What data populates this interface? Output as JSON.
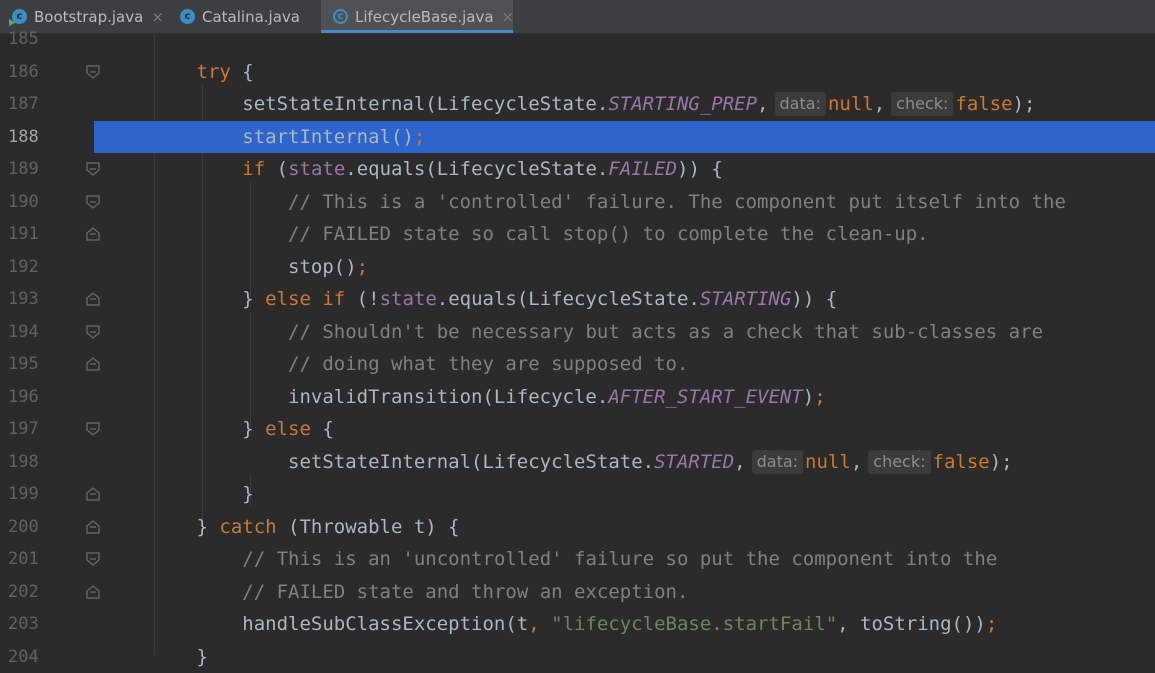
{
  "tabs": [
    {
      "label": "Bootstrap.java",
      "icon": "java-class-run-icon",
      "active": false
    },
    {
      "label": "Catalina.java",
      "icon": "java-class-icon",
      "active": false
    },
    {
      "label": "LifecycleBase.java",
      "icon": "java-abstract-class-icon",
      "active": true
    }
  ],
  "tab_close_glyph": "×",
  "class_letter": "c",
  "editor": {
    "current_line": 188,
    "lines": [
      {
        "num": "185",
        "fold": "none",
        "tokens": []
      },
      {
        "num": "186",
        "fold": "down",
        "tokens": [
          {
            "t": "        "
          },
          {
            "t": "try",
            "c": "kw"
          },
          {
            "t": " {"
          }
        ]
      },
      {
        "num": "187",
        "fold": "none",
        "tokens": [
          {
            "t": "            setStateInternal(LifecycleState."
          },
          {
            "t": "STARTING_PREP",
            "c": "cst"
          },
          {
            "t": ","
          },
          {
            "t": "data:",
            "c": "hint"
          },
          {
            "t": "null",
            "c": "kw"
          },
          {
            "t": ","
          },
          {
            "t": "check:",
            "c": "hint"
          },
          {
            "t": "false",
            "c": "kw"
          },
          {
            "t": ");"
          }
        ]
      },
      {
        "num": "188",
        "fold": "none",
        "tokens": [
          {
            "t": "            startInternal()"
          },
          {
            "t": ";",
            "c": "kw"
          }
        ]
      },
      {
        "num": "189",
        "fold": "down",
        "tokens": [
          {
            "t": "            "
          },
          {
            "t": "if",
            "c": "kw"
          },
          {
            "t": " ("
          },
          {
            "t": "state",
            "c": "fld"
          },
          {
            "t": ".equals(LifecycleState."
          },
          {
            "t": "FAILED",
            "c": "cst"
          },
          {
            "t": ")) {"
          }
        ]
      },
      {
        "num": "190",
        "fold": "down",
        "tokens": [
          {
            "t": "                "
          },
          {
            "t": "// This is a 'controlled' failure. The component put itself into the",
            "c": "cmt"
          }
        ]
      },
      {
        "num": "191",
        "fold": "up",
        "tokens": [
          {
            "t": "                "
          },
          {
            "t": "// FAILED state so call stop() to complete the clean-up.",
            "c": "cmt"
          }
        ]
      },
      {
        "num": "192",
        "fold": "none",
        "tokens": [
          {
            "t": "                stop()"
          },
          {
            "t": ";",
            "c": "kw"
          }
        ]
      },
      {
        "num": "193",
        "fold": "up",
        "tokens": [
          {
            "t": "            } "
          },
          {
            "t": "else if",
            "c": "kw"
          },
          {
            "t": " (!"
          },
          {
            "t": "state",
            "c": "fld"
          },
          {
            "t": ".equals(LifecycleState."
          },
          {
            "t": "STARTING",
            "c": "cst"
          },
          {
            "t": ")) {"
          }
        ]
      },
      {
        "num": "194",
        "fold": "down",
        "tokens": [
          {
            "t": "                "
          },
          {
            "t": "// Shouldn't be necessary but acts as a check that sub-classes are",
            "c": "cmt"
          }
        ]
      },
      {
        "num": "195",
        "fold": "up",
        "tokens": [
          {
            "t": "                "
          },
          {
            "t": "// doing what they are supposed to.",
            "c": "cmt"
          }
        ]
      },
      {
        "num": "196",
        "fold": "none",
        "tokens": [
          {
            "t": "                invalidTransition(Lifecycle."
          },
          {
            "t": "AFTER_START_EVENT",
            "c": "cst"
          },
          {
            "t": ")"
          },
          {
            "t": ";",
            "c": "kw"
          }
        ]
      },
      {
        "num": "197",
        "fold": "down",
        "tokens": [
          {
            "t": "            } "
          },
          {
            "t": "else",
            "c": "kw"
          },
          {
            "t": " {"
          }
        ]
      },
      {
        "num": "198",
        "fold": "none",
        "tokens": [
          {
            "t": "                setStateInternal(LifecycleState."
          },
          {
            "t": "STARTED",
            "c": "cst"
          },
          {
            "t": ","
          },
          {
            "t": "data:",
            "c": "hint"
          },
          {
            "t": "null",
            "c": "kw"
          },
          {
            "t": ","
          },
          {
            "t": "check:",
            "c": "hint"
          },
          {
            "t": "false",
            "c": "kw"
          },
          {
            "t": ");"
          }
        ]
      },
      {
        "num": "199",
        "fold": "up",
        "tokens": [
          {
            "t": "            }"
          }
        ]
      },
      {
        "num": "200",
        "fold": "up",
        "tokens": [
          {
            "t": "        } "
          },
          {
            "t": "catch",
            "c": "kw"
          },
          {
            "t": " (Throwable t) {"
          }
        ]
      },
      {
        "num": "201",
        "fold": "down",
        "tokens": [
          {
            "t": "            "
          },
          {
            "t": "// This is an 'uncontrolled' failure so put the component into the",
            "c": "cmt"
          }
        ]
      },
      {
        "num": "202",
        "fold": "up",
        "tokens": [
          {
            "t": "            "
          },
          {
            "t": "// FAILED state and throw an exception.",
            "c": "cmt"
          }
        ]
      },
      {
        "num": "203",
        "fold": "none",
        "tokens": [
          {
            "t": "            handleSubClassException(t"
          },
          {
            "t": ",",
            "c": "kw"
          },
          {
            "t": " "
          },
          {
            "t": "\"lifecycleBase.startFail\"",
            "c": "str"
          },
          {
            "t": ","
          },
          {
            "t": " toString())"
          },
          {
            "t": ";",
            "c": "kw"
          }
        ]
      },
      {
        "num": "204",
        "fold": "none",
        "tokens": [
          {
            "t": "        }"
          }
        ]
      }
    ]
  }
}
